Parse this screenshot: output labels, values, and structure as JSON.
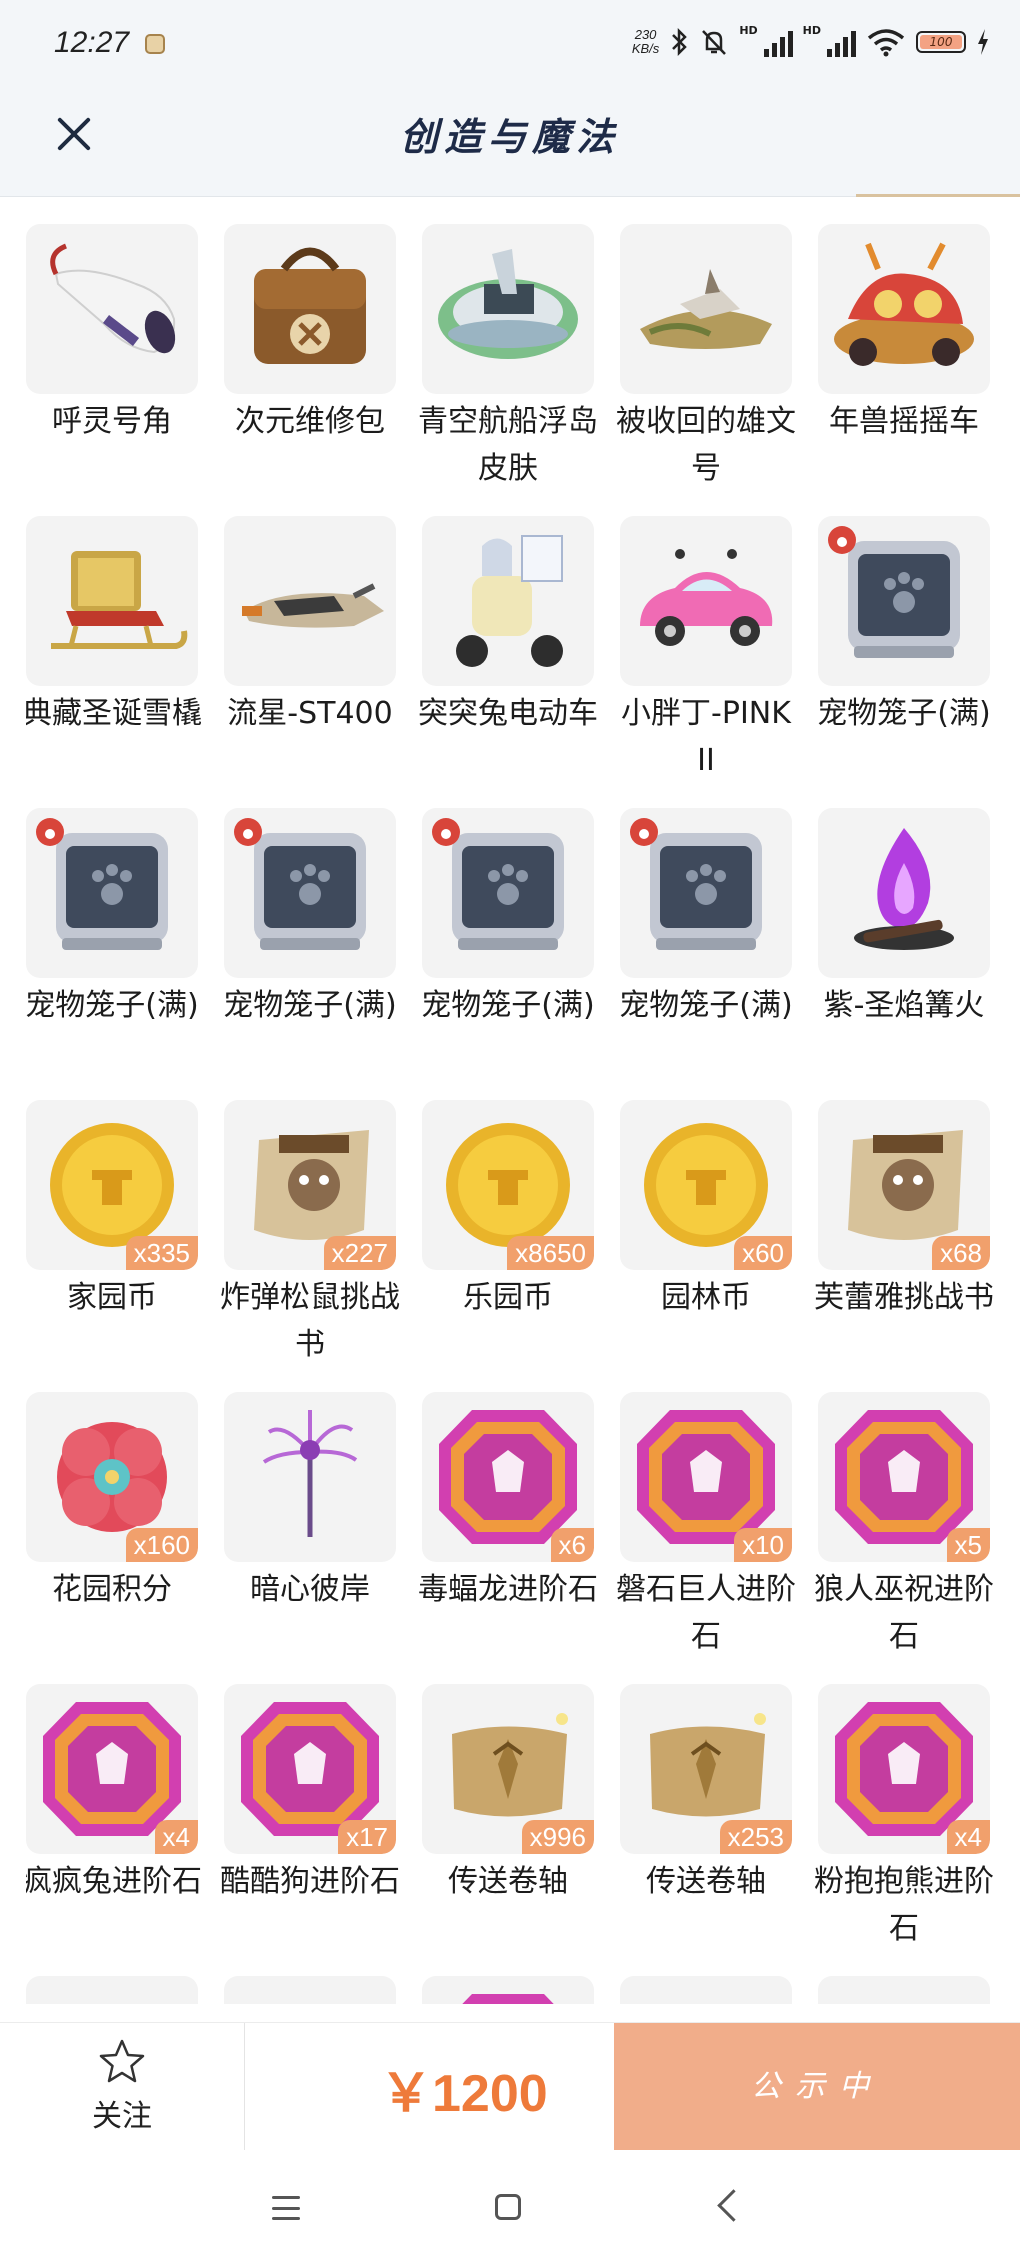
{
  "status_bar": {
    "time": "12:27",
    "net_speed_top": "230",
    "net_speed_bottom": "KB/s",
    "hd1": "HD",
    "hd2": "HD",
    "battery": "100"
  },
  "header": {
    "title": "创造与魔法"
  },
  "items": [
    {
      "name": "呼灵号角",
      "qty": "",
      "icon": "horn"
    },
    {
      "name": "次元维修包",
      "qty": "",
      "icon": "repair-bag"
    },
    {
      "name": "青空航船浮岛皮肤",
      "qty": "",
      "icon": "floating-island"
    },
    {
      "name": "被收回的雄文号",
      "qty": "",
      "icon": "ship-wreck"
    },
    {
      "name": "年兽摇摇车",
      "qty": "",
      "icon": "beast-cart"
    },
    {
      "name": "典藏圣诞雪橇",
      "qty": "",
      "icon": "sleigh"
    },
    {
      "name": "流星-ST400",
      "qty": "",
      "icon": "jet-bike"
    },
    {
      "name": "突突兔电动车",
      "qty": "",
      "icon": "scooter"
    },
    {
      "name": "小胖丁-PINK II",
      "qty": "",
      "icon": "pink-car"
    },
    {
      "name": "宠物笼子(满)",
      "qty": "",
      "icon": "pet-cage"
    },
    {
      "name": "宠物笼子(满)",
      "qty": "",
      "icon": "pet-cage"
    },
    {
      "name": "宠物笼子(满)",
      "qty": "",
      "icon": "pet-cage"
    },
    {
      "name": "宠物笼子(满)",
      "qty": "",
      "icon": "pet-cage"
    },
    {
      "name": "宠物笼子(满)",
      "qty": "",
      "icon": "pet-cage"
    },
    {
      "name": "紫-圣焰篝火",
      "qty": "",
      "icon": "purple-bonfire"
    },
    {
      "name": "家园币",
      "qty": "x335",
      "icon": "gold-coin"
    },
    {
      "name": "炸弹松鼠挑战书",
      "qty": "x227",
      "icon": "wanted-scroll"
    },
    {
      "name": "乐园币",
      "qty": "x8650",
      "icon": "gold-coin"
    },
    {
      "name": "园林币",
      "qty": "x60",
      "icon": "gold-coin"
    },
    {
      "name": "芙蕾雅挑战书",
      "qty": "x68",
      "icon": "wanted-scroll"
    },
    {
      "name": "花园积分",
      "qty": "x160",
      "icon": "flower-token"
    },
    {
      "name": "暗心彼岸",
      "qty": "",
      "icon": "spider-lily"
    },
    {
      "name": "毒蝠龙进阶石",
      "qty": "x6",
      "icon": "evolve-gem"
    },
    {
      "name": "磐石巨人进阶石",
      "qty": "x10",
      "icon": "evolve-gem"
    },
    {
      "name": "狼人巫祝进阶石",
      "qty": "x5",
      "icon": "evolve-gem"
    },
    {
      "name": "疯疯兔进阶石",
      "qty": "x4",
      "icon": "evolve-gem"
    },
    {
      "name": "酷酷狗进阶石",
      "qty": "x17",
      "icon": "evolve-gem"
    },
    {
      "name": "传送卷轴",
      "qty": "x996",
      "icon": "teleport-scroll"
    },
    {
      "name": "传送卷轴",
      "qty": "x253",
      "icon": "teleport-scroll"
    },
    {
      "name": "粉抱抱熊进阶石",
      "qty": "x4",
      "icon": "evolve-gem"
    },
    {
      "name": "",
      "qty": "",
      "icon": "plant"
    },
    {
      "name": "",
      "qty": "",
      "icon": "plant"
    },
    {
      "name": "",
      "qty": "",
      "icon": "evolve-gem"
    },
    {
      "name": "",
      "qty": "",
      "icon": "blank"
    },
    {
      "name": "",
      "qty": "",
      "icon": "crystal"
    }
  ],
  "bottom_bar": {
    "follow_label": "关注",
    "price": "￥1200",
    "status_label": "公示中"
  },
  "colors": {
    "accent": "#ee7a3a",
    "qty_badge": "#f1a06c",
    "status_button": "#f1ad8a",
    "header_bg": "#f3f6f9",
    "title": "#1e2b48"
  }
}
